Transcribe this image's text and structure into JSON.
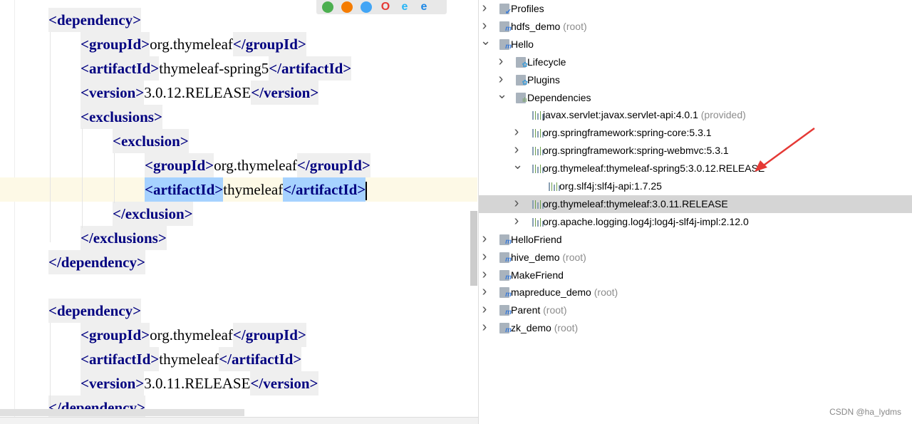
{
  "editor": {
    "lines": [
      {
        "indent": 0,
        "open": "<dependency>",
        "value": "",
        "close": ""
      },
      {
        "indent": 1,
        "open": "<groupId>",
        "value": "org.thymeleaf",
        "close": "</groupId>"
      },
      {
        "indent": 1,
        "open": "<artifactId>",
        "value": "thymeleaf-spring5",
        "close": "</artifactId>"
      },
      {
        "indent": 1,
        "open": "<version>",
        "value": "3.0.12.RELEASE",
        "close": "</version>"
      },
      {
        "indent": 1,
        "open": "<exclusions>",
        "value": "",
        "close": ""
      },
      {
        "indent": 2,
        "open": "<exclusion>",
        "value": "",
        "close": ""
      },
      {
        "indent": 3,
        "open": "<groupId>",
        "value": "org.thymeleaf",
        "close": "</groupId>"
      },
      {
        "indent": 3,
        "open": "<artifactId>",
        "value": "thymeleaf",
        "close": "</artifactId>",
        "current": true,
        "selected": true
      },
      {
        "indent": 2,
        "open": "</exclusion>",
        "value": "",
        "close": ""
      },
      {
        "indent": 1,
        "open": "</exclusions>",
        "value": "",
        "close": ""
      },
      {
        "indent": 0,
        "open": "</dependency>",
        "value": "",
        "close": ""
      },
      null,
      {
        "indent": 0,
        "open": "<dependency>",
        "value": "",
        "close": ""
      },
      {
        "indent": 1,
        "open": "<groupId>",
        "value": "org.thymeleaf",
        "close": "</groupId>"
      },
      {
        "indent": 1,
        "open": "<artifactId>",
        "value": "thymeleaf",
        "close": "</artifactId>"
      },
      {
        "indent": 1,
        "open": "<version>",
        "value": "3.0.11.RELEASE",
        "close": "</version>"
      },
      {
        "indent": 0,
        "open": "</dependency>",
        "value": "",
        "close": ""
      }
    ],
    "browsers": [
      {
        "name": "chrome-icon",
        "glyph": "●",
        "color": "#4caf50"
      },
      {
        "name": "firefox-icon",
        "glyph": "●",
        "color": "#f57c00"
      },
      {
        "name": "safari-icon",
        "glyph": "●",
        "color": "#42a5f5"
      },
      {
        "name": "opera-icon",
        "glyph": "O",
        "color": "#e53935"
      },
      {
        "name": "ie-icon",
        "glyph": "e",
        "color": "#29b6f6"
      },
      {
        "name": "edge-icon",
        "glyph": "e",
        "color": "#1e88e5"
      }
    ]
  },
  "maven_tree": {
    "rows": [
      {
        "level": 0,
        "arrow": "collapsed",
        "icon": "profiles",
        "label": "Profiles",
        "suffix": ""
      },
      {
        "level": 0,
        "arrow": "collapsed",
        "icon": "module",
        "label": "hdfs_demo",
        "suffix": "(root)"
      },
      {
        "level": 0,
        "arrow": "expanded",
        "icon": "module",
        "label": "Hello",
        "suffix": ""
      },
      {
        "level": 1,
        "arrow": "collapsed",
        "icon": "lifecycle",
        "label": "Lifecycle",
        "suffix": ""
      },
      {
        "level": 1,
        "arrow": "collapsed",
        "icon": "plugins",
        "label": "Plugins",
        "suffix": ""
      },
      {
        "level": 1,
        "arrow": "expanded",
        "icon": "dependencies",
        "label": "Dependencies",
        "suffix": ""
      },
      {
        "level": 2,
        "arrow": "none",
        "icon": "library",
        "label": "javax.servlet:javax.servlet-api:4.0.1",
        "suffix": "(provided)"
      },
      {
        "level": 2,
        "arrow": "collapsed",
        "icon": "library",
        "label": "org.springframework:spring-core:5.3.1",
        "suffix": ""
      },
      {
        "level": 2,
        "arrow": "collapsed",
        "icon": "library",
        "label": "org.springframework:spring-webmvc:5.3.1",
        "suffix": ""
      },
      {
        "level": 2,
        "arrow": "expanded",
        "icon": "library",
        "label": "org.thymeleaf:thymeleaf-spring5:3.0.12.RELEASE",
        "suffix": ""
      },
      {
        "level": 3,
        "arrow": "none",
        "icon": "library",
        "label": "org.slf4j:slf4j-api:1.7.25",
        "suffix": ""
      },
      {
        "level": 2,
        "arrow": "collapsed",
        "icon": "library",
        "label": "org.thymeleaf:thymeleaf:3.0.11.RELEASE",
        "suffix": "",
        "selected": true
      },
      {
        "level": 2,
        "arrow": "collapsed",
        "icon": "library",
        "label": "org.apache.logging.log4j:log4j-slf4j-impl:2.12.0",
        "suffix": ""
      },
      {
        "level": 0,
        "arrow": "collapsed",
        "icon": "module",
        "label": "HelloFriend",
        "suffix": ""
      },
      {
        "level": 0,
        "arrow": "collapsed",
        "icon": "module",
        "label": "hive_demo",
        "suffix": "(root)"
      },
      {
        "level": 0,
        "arrow": "collapsed",
        "icon": "module",
        "label": "MakeFriend",
        "suffix": ""
      },
      {
        "level": 0,
        "arrow": "collapsed",
        "icon": "module",
        "label": "mapreduce_demo",
        "suffix": "(root)"
      },
      {
        "level": 0,
        "arrow": "collapsed",
        "icon": "module",
        "label": "Parent",
        "suffix": "(root)"
      },
      {
        "level": 0,
        "arrow": "collapsed",
        "icon": "module",
        "label": "zk_demo",
        "suffix": "(root)"
      }
    ]
  },
  "annotation_color": "#e53935",
  "watermark": "CSDN @ha_lydms"
}
